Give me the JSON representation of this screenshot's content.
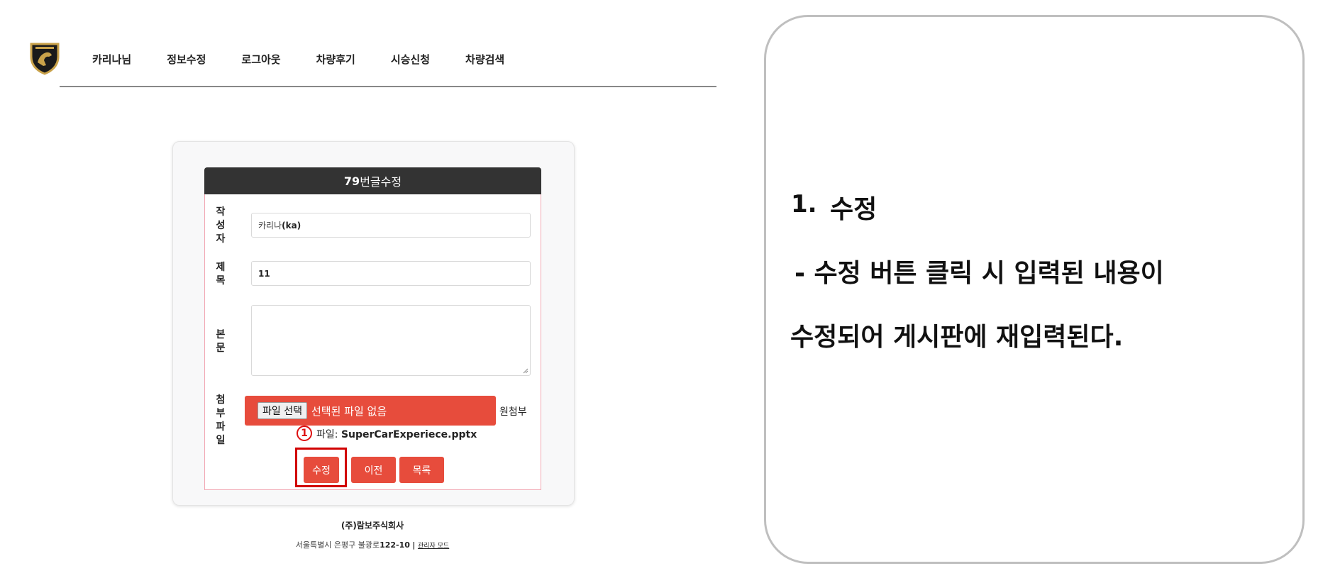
{
  "nav": {
    "items": [
      "카리나님",
      "정보수정",
      "로그아웃",
      "차량후기",
      "시승신청",
      "차량검색"
    ]
  },
  "form": {
    "title_number": "79",
    "title_text": "번글수정",
    "labels": {
      "author": [
        "작",
        "성",
        "자"
      ],
      "title": [
        "제",
        "목"
      ],
      "body": [
        "본",
        "문"
      ],
      "attachment": [
        "첨",
        "부",
        "파",
        "일"
      ]
    },
    "author_value_prefix": "카리나",
    "author_value_id": "(ka)",
    "title_value": "11",
    "body_value": "",
    "file_button": "파일 선택",
    "file_status": "선택된 파일 없음",
    "original_file_label_a": "원첨부",
    "original_file_label_b": "파일: ",
    "original_file_name": "SuperCarExperiece.pptx",
    "marker": "1",
    "buttons": {
      "edit": "수정",
      "prev": "이전",
      "list": "목록"
    }
  },
  "footer": {
    "company": "(주)람보주식회사",
    "address": "서울특별시 은평구 불광로",
    "address_number": "122-10",
    "separator": "|",
    "admin_mode": "관리자 모드"
  },
  "annotation": {
    "heading_number": "1.",
    "heading": "수정",
    "line1": "- 수정 버튼 클릭 시 입력된 내용이",
    "line2": "수정되어 게시판에 재입력된다."
  },
  "colors": {
    "accent": "#e74c3c",
    "header_dark": "#333333",
    "highlight": "#d10000",
    "form_border": "#f2a8b4"
  }
}
